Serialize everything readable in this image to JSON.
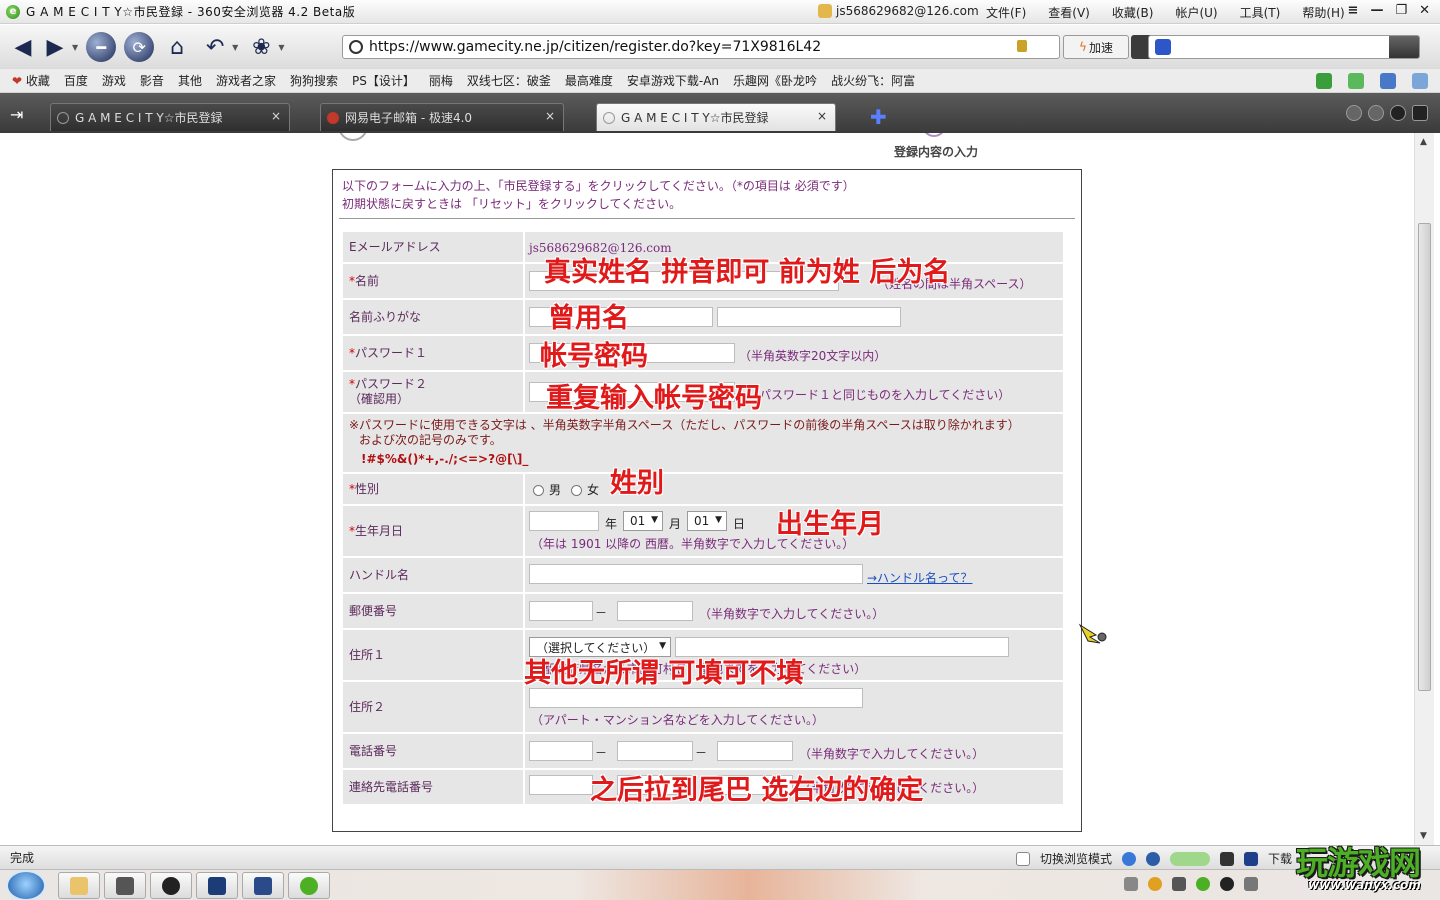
{
  "window": {
    "title": "G A M E C I T Y☆市民登録 - 360安全浏览器 4.2 Beta版",
    "user": "js568629682@126.com",
    "menus": [
      "文件(F)",
      "查看(V)",
      "收藏(B)",
      "帐户(U)",
      "工具(T)",
      "帮助(H)"
    ],
    "controls": [
      "≡",
      "—",
      "❐",
      "✕"
    ]
  },
  "toolbar": {
    "url": "https://www.gamecity.ne.jp/citizen/register.do?key=71X9816L42",
    "speed_label": "加速"
  },
  "favorites": {
    "collect_label": "收藏",
    "items": [
      "百度",
      "游戏",
      "影音",
      "其他",
      "游戏者之家",
      "狗狗搜索",
      "PS【设计】",
      "丽梅",
      "双线七区：破釜",
      "最高难度",
      "安卓游戏下载-An",
      "乐趣网《卧龙吟",
      "战火纷飞：阿富"
    ]
  },
  "tabs": [
    {
      "label": "G A M E C I T Y☆市民登録",
      "close": "×"
    },
    {
      "label": "网易电子邮箱 - 极速4.0",
      "close": "×"
    },
    {
      "label": "G A M E C I T Y☆市民登録",
      "close": "×"
    }
  ],
  "page": {
    "step_label": "登録内容の入力",
    "intro_line1": "以下のフォームに入力の上、「市民登録する」をクリックしてください。（*の項目は 必須です）",
    "intro_line2": "初期状態に戻すときは 「リセット」をクリックしてください。",
    "fields": {
      "email_label": "Eメールアドレス",
      "email_value": "js568629682@126.com",
      "name_label": "名前",
      "name_note": "（姓名の間は半角スペース）",
      "furigana_label": "名前ふりがな",
      "password1_label": "パスワード１",
      "password1_note": "（半角英数字20文字以内）",
      "password2_label": "パスワード２",
      "password2_sub": "（確認用）",
      "password2_note": "（パスワード１と同じものを入力してください）",
      "pw_rule_line1": "※パスワードに使用できる文字は 、半角英数字半角スペース（ただし、パスワードの前後の半角スペースは取り除かれます）",
      "pw_rule_line2": "および次の記号のみです。",
      "pw_rule_symbols": "!#$%&()*+,-./;<=>?@[\\]_",
      "gender_label": "性別",
      "gender_male": "男",
      "gender_female": "女",
      "birth_label": "生年月日",
      "birth_year_unit": "年",
      "birth_month": "01",
      "birth_month_unit": "月",
      "birth_day": "01",
      "birth_day_unit": "日",
      "birth_note": "（年は 1901 以降の 西暦。半角数字で入力してください。）",
      "handle_label": "ハンドル名",
      "handle_link": "→ハンドル名って？",
      "postal_label": "郵便番号",
      "postal_note": "（半角数字で入力してください。）",
      "address1_label": "住所１",
      "address1_select": "（選択してください）",
      "address1_note": "（都道府県名から市区町村名、番地までを入力してください）",
      "address2_label": "住所２",
      "address2_note": "（アパート・マンション名などを入力してください。）",
      "phone_label": "電話番号",
      "phone_note": "（半角数字で入力してください。）",
      "contact_label": "連絡先電話番号",
      "contact_note": "（半角数字で入力してください。）",
      "dash": "－",
      "required_mark": "*"
    },
    "annotations": {
      "name": "真实姓名  拼音即可    前为姓  后为名",
      "furigana": "曾用名",
      "password": "帐号密码",
      "password_repeat": "重复输入帐号密码",
      "gender": "姓别",
      "birth": "出生年月",
      "others": "其他无所谓  可填可不填",
      "end": "之后拉到尾巴  选右边的确定"
    }
  },
  "statusbar": {
    "status": "完成",
    "mode_label": "切换浏览模式",
    "download_label": "下载"
  },
  "watermark": {
    "big": "玩游戏网",
    "small": "www.wanyx.com"
  },
  "colors": {
    "annotation": "#e01a1a",
    "label": "#5b2a5b",
    "link": "#1a4fc4",
    "row_bg": "#e6e6e6"
  }
}
